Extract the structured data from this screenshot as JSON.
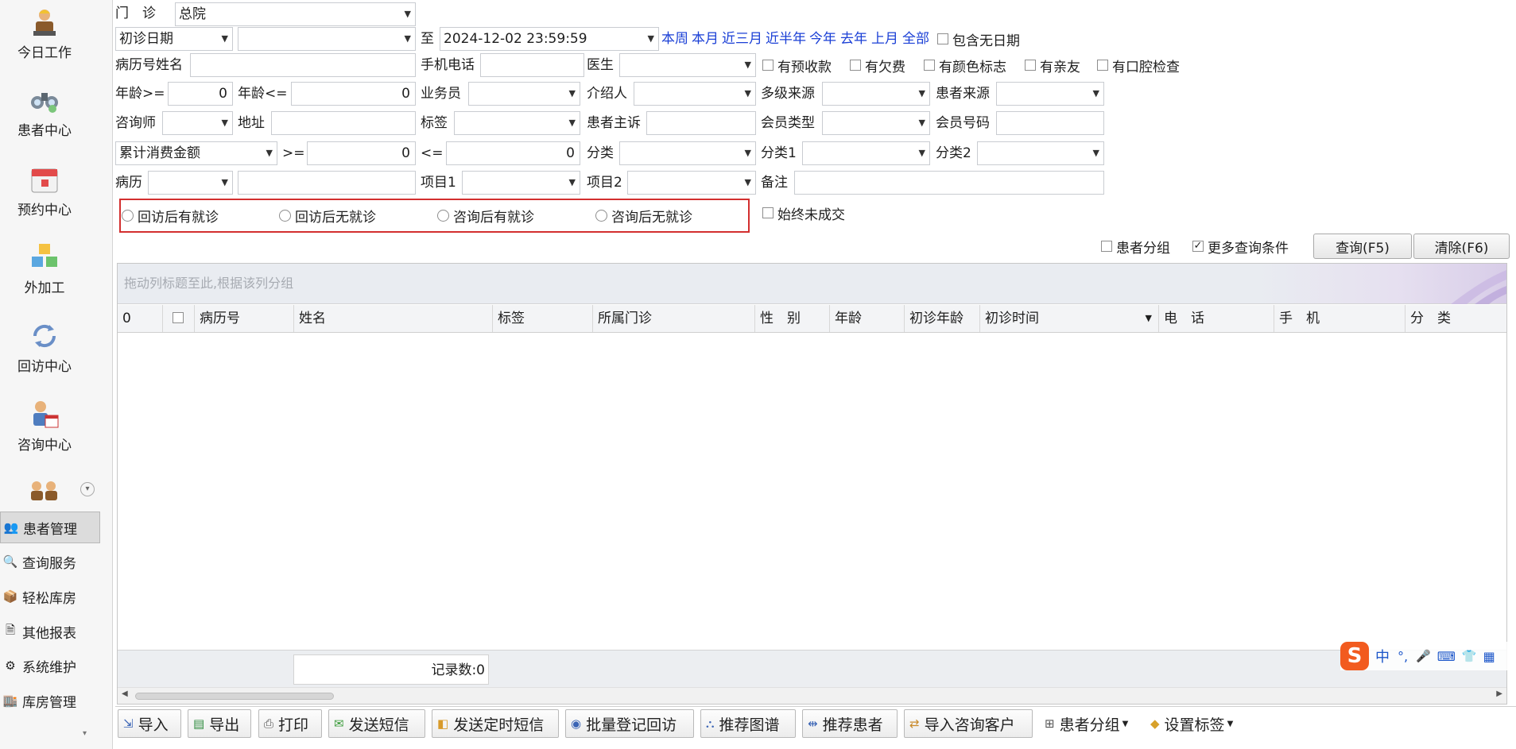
{
  "sidebar": {
    "big_items": [
      {
        "label": "今日工作",
        "icon": "worker-icon"
      },
      {
        "label": "患者中心",
        "icon": "binoculars-icon"
      },
      {
        "label": "预约中心",
        "icon": "calendar-icon"
      },
      {
        "label": "外加工",
        "icon": "cubes-icon"
      },
      {
        "label": "回访中心",
        "icon": "refresh-icon"
      },
      {
        "label": "咨询中心",
        "icon": "consultant-icon"
      }
    ],
    "small_items": [
      {
        "label": "患者管理"
      },
      {
        "label": "查询服务"
      },
      {
        "label": "轻松库房"
      },
      {
        "label": "其他报表"
      },
      {
        "label": "系统维护"
      },
      {
        "label": "库房管理"
      }
    ]
  },
  "filters": {
    "clinic_label": "门　诊",
    "clinic_value": "总院",
    "date_type": "初诊日期",
    "date_from": "",
    "to_label": "至",
    "date_to": "2024-12-02 23:59:59",
    "date_links": [
      "本周",
      "本月",
      "近三月",
      "近半年",
      "今年",
      "去年",
      "上月",
      "全部"
    ],
    "include_no_date": "包含无日期",
    "record_name_label": "病历号姓名",
    "phone_label": "手机电话",
    "doctor_label": "医生",
    "has_prepay": "有预收款",
    "has_debt": "有欠费",
    "has_color": "有颜色标志",
    "has_relative": "有亲友",
    "has_oral_check": "有口腔检查",
    "age_min_label": "年龄>=",
    "age_min": "0",
    "age_max_label": "年龄<=",
    "age_max": "0",
    "salesman_label": "业务员",
    "introducer_label": "介绍人",
    "multi_source_label": "多级来源",
    "patient_source_label": "患者来源",
    "consultant_label": "咨询师",
    "address_label": "地址",
    "tag_label": "标签",
    "complaint_label": "患者主诉",
    "member_type_label": "会员类型",
    "member_no_label": "会员号码",
    "amount_type": "累计消费金额",
    "gte_label": ">=",
    "amount_min": "0",
    "lte_label": "<=",
    "amount_max": "0",
    "category_label": "分类",
    "category1_label": "分类1",
    "category2_label": "分类2",
    "history_label": "病历",
    "item1_label": "项目1",
    "item2_label": "项目2",
    "note_label": "备注",
    "radios": [
      "回访后有就诊",
      "回访后无就诊",
      "咨询后有就诊",
      "咨询后无就诊"
    ],
    "never_deal": "始终未成交",
    "patient_group": "患者分组",
    "more_conditions": "更多查询条件",
    "query_button": "查询(F5)",
    "clear_button": "清除(F6)"
  },
  "grid": {
    "group_hint": "拖动列标题至此,根据该列分组",
    "columns": [
      "0",
      "",
      "病历号",
      "姓名",
      "标签",
      "所属门诊",
      "性　别",
      "年龄",
      "初诊年龄",
      "初诊时间",
      "电　话",
      "手　机",
      "分　类"
    ],
    "record_count": "记录数:0"
  },
  "toolbar": [
    {
      "label": "导入",
      "icon": "import-icon"
    },
    {
      "label": "导出",
      "icon": "export-icon"
    },
    {
      "label": "打印",
      "icon": "print-icon"
    },
    {
      "label": "发送短信",
      "icon": "sms-icon"
    },
    {
      "label": "发送定时短信",
      "icon": "timed-sms-icon"
    },
    {
      "label": "批量登记回访",
      "icon": "batch-visit-icon"
    },
    {
      "label": "推荐图谱",
      "icon": "tree-icon"
    },
    {
      "label": "推荐患者",
      "icon": "recommend-icon"
    },
    {
      "label": "导入咨询客户",
      "icon": "import-customer-icon"
    },
    {
      "label": "患者分组",
      "icon": "group-icon"
    },
    {
      "label": "设置标签",
      "icon": "tag-icon"
    }
  ],
  "ime": {
    "logo": "S",
    "items": [
      "中",
      "°,",
      "🎤",
      "⌨",
      "👕",
      "▦"
    ]
  },
  "colors": {
    "link": "#1a3fd6",
    "highlight_border": "#d32f2f",
    "ime_orange": "#f25b1f"
  }
}
